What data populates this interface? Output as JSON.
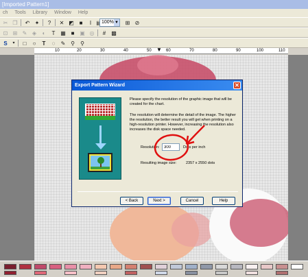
{
  "window": {
    "title": "[Imported Pattern1]"
  },
  "menu": {
    "items": [
      "ch",
      "Tools",
      "Library",
      "Window",
      "Help"
    ]
  },
  "toolbar": {
    "zoom_value": "100%"
  },
  "ruler": {
    "labels": [
      "10",
      "20",
      "30",
      "40",
      "50",
      "60",
      "70",
      "80",
      "90",
      "100",
      "110"
    ]
  },
  "dialog": {
    "title": "Export Pattern Wizard",
    "paragraph1": "Please specify the resolution of the graphic image that will be created for the chart.",
    "paragraph2": "The resolution will determine the detail of the image.  The higher the resolution, the better result you will get when printing on a high-resolution printer.  However, increasing the resolution also increases the disk space needed.",
    "resolution_label": "Resolution:",
    "resolution_value": "300",
    "resolution_unit": "Dots per inch",
    "image_size_label": "Resulting image size:",
    "image_size_value": "2357 x 2550 dots",
    "buttons": {
      "back": "< Back",
      "next": "Next >",
      "cancel": "Cancel",
      "help": "Help"
    }
  },
  "colors": {
    "dialog_title": "#0a58d6",
    "annotation": "#e01010",
    "santa_red": "#c8506a",
    "skin": "#f0b89a"
  }
}
